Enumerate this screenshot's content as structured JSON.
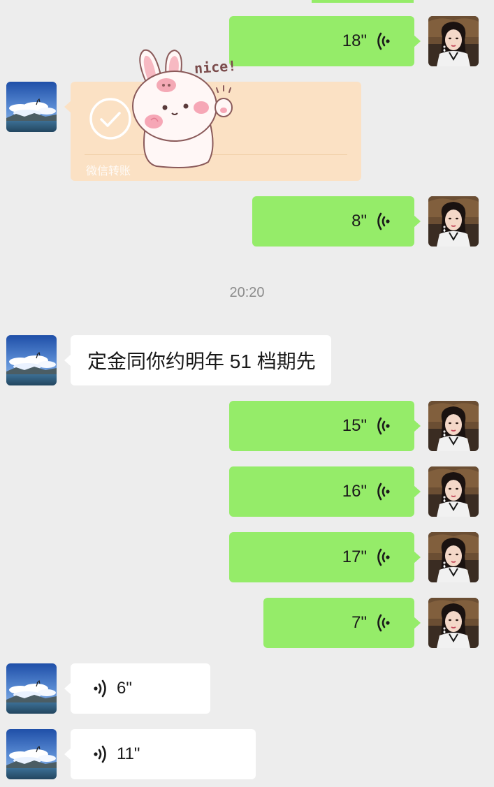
{
  "timestamp": "20:20",
  "transfer": {
    "label": "微信转账"
  },
  "sticker": {
    "text": "nice!"
  },
  "messages": [
    {
      "id": 1,
      "side": "out",
      "type": "voice",
      "duration": "18\""
    },
    {
      "id": 2,
      "side": "in",
      "type": "transfer"
    },
    {
      "id": 3,
      "side": "out",
      "type": "voice",
      "duration": "8\""
    },
    {
      "id": 4,
      "side": "in",
      "type": "text",
      "text": "定金同你约明年 51 档期先"
    },
    {
      "id": 5,
      "side": "out",
      "type": "voice",
      "duration": "15\""
    },
    {
      "id": 6,
      "side": "out",
      "type": "voice",
      "duration": "16\""
    },
    {
      "id": 7,
      "side": "out",
      "type": "voice",
      "duration": "17\""
    },
    {
      "id": 8,
      "side": "out",
      "type": "voice",
      "duration": "7\""
    },
    {
      "id": 9,
      "side": "in",
      "type": "voice",
      "duration": "6\""
    },
    {
      "id": 10,
      "side": "in",
      "type": "voice",
      "duration": "11\""
    }
  ],
  "colors": {
    "background": "#ededed",
    "outgoing_bubble": "#95ec69",
    "incoming_bubble": "#ffffff",
    "transfer_bubble": "#fbe1c4",
    "timestamp_text": "#8c8c8c"
  },
  "icons": {
    "voice": "voice-wave-icon",
    "transfer": "checkmark-circle-icon"
  }
}
